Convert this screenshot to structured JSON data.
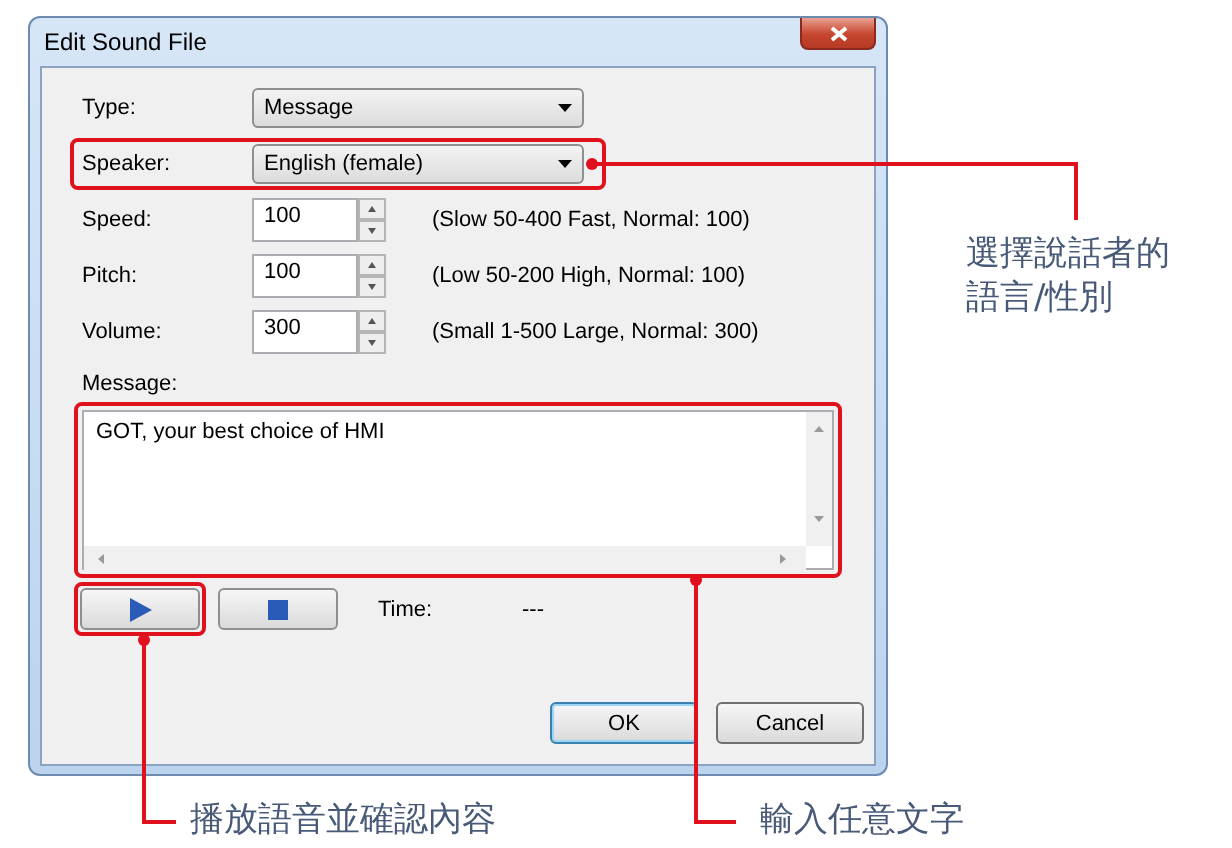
{
  "window": {
    "title": "Edit Sound File"
  },
  "fields": [
    {
      "kind": "dropdown",
      "label": "Type:",
      "value": "Message",
      "highlighted": false
    },
    {
      "kind": "dropdown",
      "label": "Speaker:",
      "value": "English (female)",
      "highlighted": true,
      "callout": [
        "選擇說話者的",
        "語言/性別"
      ]
    },
    {
      "kind": "spinner",
      "label": "Speed:",
      "value": "100",
      "hint": "(Slow 50-400 Fast, Normal: 100)",
      "highlighted": false
    },
    {
      "kind": "spinner",
      "label": "Pitch:",
      "value": "100",
      "hint": "(Low 50-200 High, Normal: 100)",
      "highlighted": false
    },
    {
      "kind": "spinner",
      "label": "Volume:",
      "value": "300",
      "hint": "(Small 1-500 Large, Normal: 300)",
      "highlighted": false
    }
  ],
  "message": {
    "label": "Message:",
    "value": "GOT, your best choice of HMI",
    "highlighted": true,
    "callout": [
      "輸入任意文字"
    ]
  },
  "playback": {
    "play_highlighted": true,
    "time_label": "Time:",
    "time_value": "---",
    "callout": [
      "播放語音並確認內容"
    ]
  },
  "buttons": [
    {
      "label": "OK",
      "default": true
    },
    {
      "label": "Cancel",
      "default": false
    }
  ]
}
